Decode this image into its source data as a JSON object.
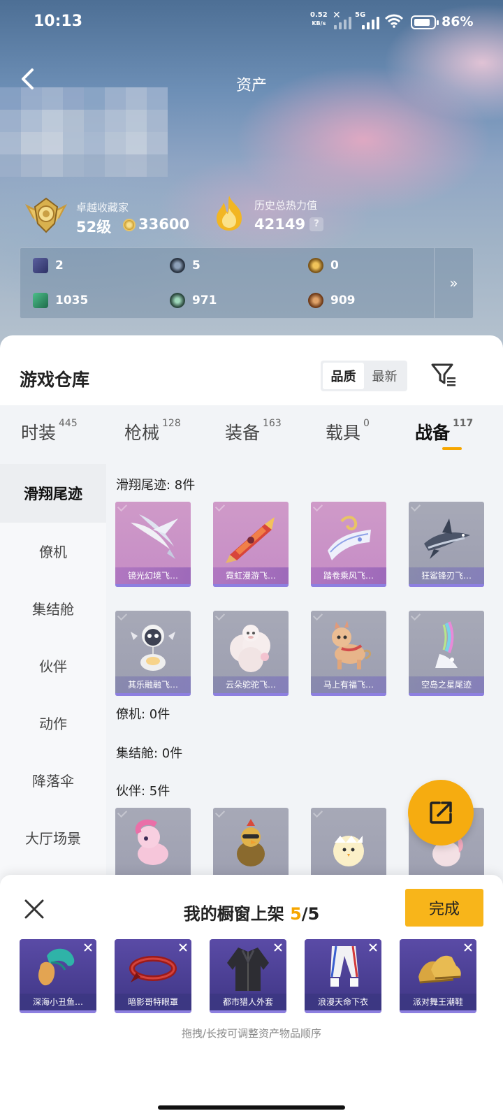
{
  "status": {
    "time": "10:13",
    "net_speed": "0.52",
    "net_unit": "KB/s",
    "network": "5G",
    "battery": "86%",
    "battery_level": 0.86
  },
  "header": {
    "title": "资产"
  },
  "profile": {
    "rank_label": "卓越收藏家",
    "rank_level": "52级",
    "coins": "33600",
    "heat_label": "历史总热力值",
    "heat_value": "42149",
    "help": "?"
  },
  "currencies": [
    {
      "value": "2",
      "icon": "card-ticket-icon",
      "color": "#4a4f86"
    },
    {
      "value": "5",
      "icon": "silver-badge-icon",
      "color": "#3d4756"
    },
    {
      "value": "0",
      "icon": "gold-badge-icon",
      "color": "#a87b2a"
    },
    {
      "value": "1035",
      "icon": "green-ticket-icon",
      "color": "#2f8a63"
    },
    {
      "value": "971",
      "icon": "green-orb-icon",
      "color": "#3e6e5c"
    },
    {
      "value": "909",
      "icon": "bronze-coin-icon",
      "color": "#9a5a2a"
    }
  ],
  "currency_more": "»",
  "warehouse": {
    "title": "游戏仓库",
    "sort_options": [
      "品质",
      "最新"
    ],
    "sort_active": "品质"
  },
  "tabs": [
    {
      "label": "时装",
      "count": "445"
    },
    {
      "label": "枪械",
      "count": "128"
    },
    {
      "label": "装备",
      "count": "163"
    },
    {
      "label": "载具",
      "count": "0"
    },
    {
      "label": "战备",
      "count": "117"
    }
  ],
  "sidebar": [
    "滑翔尾迹",
    "僚机",
    "集结舱",
    "伙伴",
    "动作",
    "降落伞",
    "大厅场景"
  ],
  "sections": {
    "glide_label": "滑翔尾迹: 8件",
    "wingman_label": "僚机: 0件",
    "pod_label": "集结舱: 0件",
    "partner_label": "伙伴: 5件"
  },
  "glide_items": [
    "镜光幻境飞…",
    "霓虹漫游飞…",
    "踏卷乘风飞…",
    "狂鲨锋刃飞…",
    "其乐融融飞…",
    "云朵驼驼飞…",
    "马上有福飞…",
    "空岛之星尾迹"
  ],
  "shelf": {
    "title_prefix": "我的橱窗上架",
    "count": "5",
    "total": "/5",
    "done": "完成",
    "items": [
      "深海小丑鱼…",
      "暗影哥特眼罩",
      "都市猎人外套",
      "浪漫天命下衣",
      "派对舞王潮鞋"
    ],
    "hint": "拖拽/长按可调整资产物品顺序"
  },
  "colors": {
    "accent": "#f6a600",
    "button": "#f8b51a",
    "rare_purple": "#c58cc6",
    "epic_tag": "#8d7fe0"
  }
}
